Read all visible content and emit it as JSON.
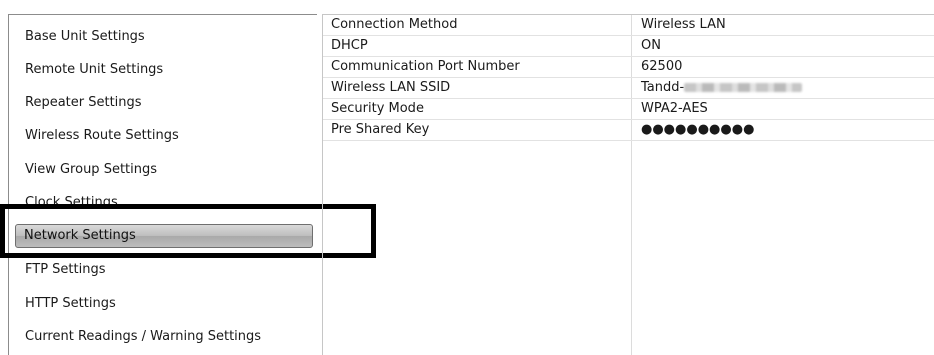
{
  "nav": {
    "items": [
      "Base Unit Settings",
      "Remote Unit Settings",
      "Repeater Settings",
      "Wireless Route Settings",
      "View Group Settings",
      "Clock Settings",
      "Network Settings",
      "FTP Settings",
      "HTTP Settings",
      "Current Readings / Warning Settings"
    ],
    "selected": "Network Settings"
  },
  "properties": [
    {
      "name": "Connection Method",
      "value": "Wireless LAN"
    },
    {
      "name": "DHCP",
      "value": "ON"
    },
    {
      "name": "Communication Port Number",
      "value": "62500"
    },
    {
      "name": "Wireless LAN SSID",
      "value": "Tandd-"
    },
    {
      "name": "Security Mode",
      "value": "WPA2-AES"
    },
    {
      "name": "Pre Shared Key",
      "value": "●●●●●●●●●●"
    }
  ]
}
